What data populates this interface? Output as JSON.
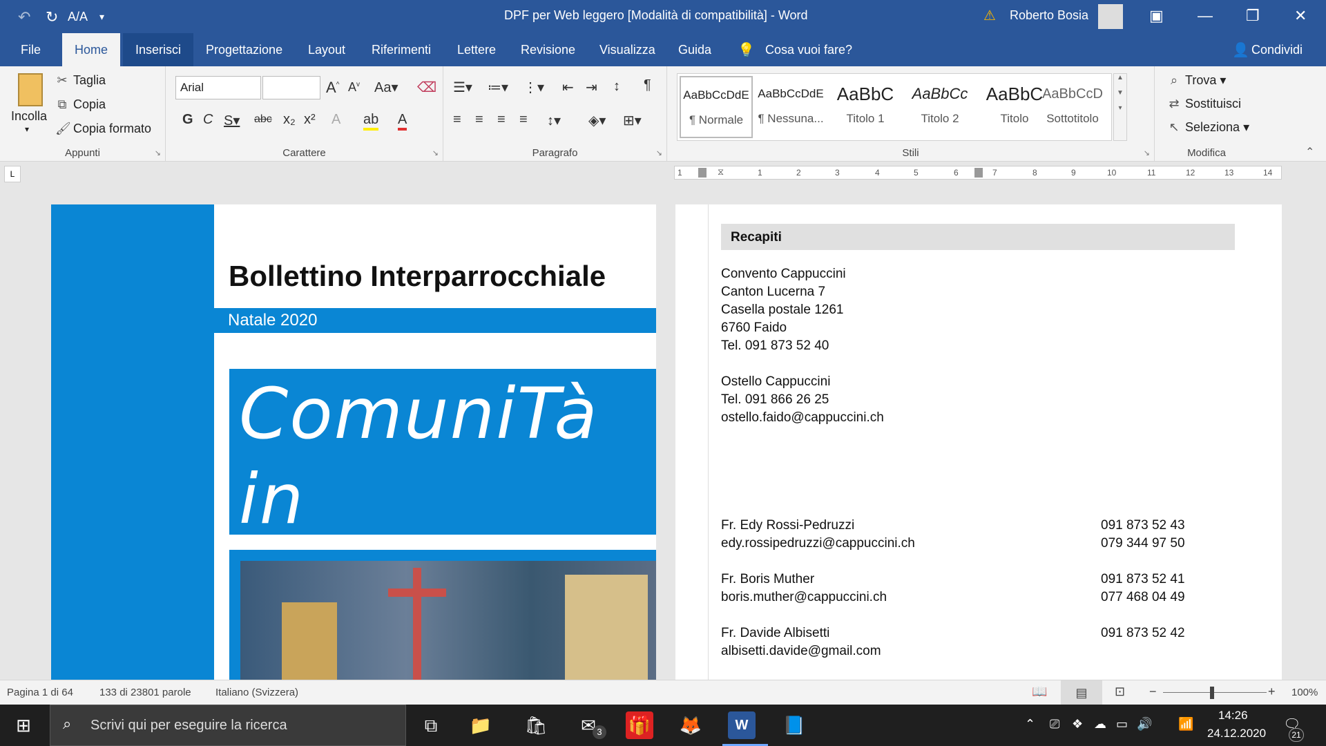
{
  "titlebar": {
    "title": "DPF per Web leggero [Modalità di compatibilità]  -  Word",
    "user": "Roberto Bosia",
    "colors": {
      "accent": "#2b579a"
    }
  },
  "tabs": [
    {
      "label": "File"
    },
    {
      "label": "Home"
    },
    {
      "label": "Inserisci"
    },
    {
      "label": "Progettazione"
    },
    {
      "label": "Layout"
    },
    {
      "label": "Riferimenti"
    },
    {
      "label": "Lettere"
    },
    {
      "label": "Revisione"
    },
    {
      "label": "Visualizza"
    },
    {
      "label": "Guida"
    }
  ],
  "tell_me": "Cosa vuoi fare?",
  "share": "Condividi",
  "clipboard": {
    "paste": "Incolla",
    "cut": "Taglia",
    "copy": "Copia",
    "format_painter": "Copia formato",
    "group": "Appunti"
  },
  "font": {
    "family": "Arial",
    "size": "",
    "group": "Carattere"
  },
  "paragraph": {
    "group": "Paragrafo"
  },
  "styles": {
    "group": "Stili",
    "items": [
      {
        "preview": "AaBbCcDdE",
        "name": "¶ Normale"
      },
      {
        "preview": "AaBbCcDdE",
        "name": "¶ Nessuna..."
      },
      {
        "preview": "AaBbC",
        "name": "Titolo 1"
      },
      {
        "preview": "AaBbCc",
        "name": "Titolo 2"
      },
      {
        "preview": "AaBbC",
        "name": "Titolo"
      },
      {
        "preview": "AaBbCcD",
        "name": "Sottotitolo"
      }
    ]
  },
  "editing": {
    "find": "Trova",
    "replace": "Sostituisci",
    "select": "Seleziona",
    "group": "Modifica"
  },
  "ruler": {
    "ticks": [
      "1",
      "1",
      "2",
      "3",
      "4",
      "5",
      "6",
      "7",
      "8",
      "9",
      "10",
      "11",
      "12",
      "13",
      "14"
    ]
  },
  "page1": {
    "title": "Bollettino Interparrocchiale",
    "subtitle": "Natale 2020",
    "logo_line1": "ComuniTà",
    "logo_line2": "in cammino",
    "colors": {
      "blue": "#0a86d4"
    }
  },
  "page2": {
    "heading": "Recapiti",
    "address": [
      "Convento Cappuccini",
      "Canton Lucerna 7",
      "Casella postale 1261",
      "6760 Faido"
    ],
    "tel": "Tel. 091 873 52 40",
    "hostel": [
      "Ostello Cappuccini",
      "Tel. 091 866 26 25",
      "ostello.faido@cappuccini.ch"
    ],
    "contacts": [
      {
        "name": "Fr. Edy Rossi-Pedruzzi",
        "email": "edy.rossipedruzzi@cappuccini.ch",
        "phone1": "091 873 52 43",
        "phone2": "079 344 97 50"
      },
      {
        "name": "Fr. Boris Muther",
        "email": "boris.muther@cappuccini.ch",
        "phone1": "091 873 52 41",
        "phone2": "077 468 04 49"
      },
      {
        "name": "Fr. Davide Albisetti",
        "email": "albisetti.davide@gmail.com",
        "phone1": "091 873 52 42",
        "phone2": ""
      }
    ]
  },
  "status": {
    "page": "Pagina 1 di 64",
    "words": "133 di 23801 parole",
    "language": "Italiano (Svizzera)",
    "zoom": "100%",
    "zoom_minus": "−",
    "zoom_plus": "+"
  },
  "taskbar": {
    "search": "Scrivi qui per eseguire la ricerca",
    "time": "14:26",
    "date": "24.12.2020",
    "mail_badge": "3",
    "notif_badge": "21"
  }
}
